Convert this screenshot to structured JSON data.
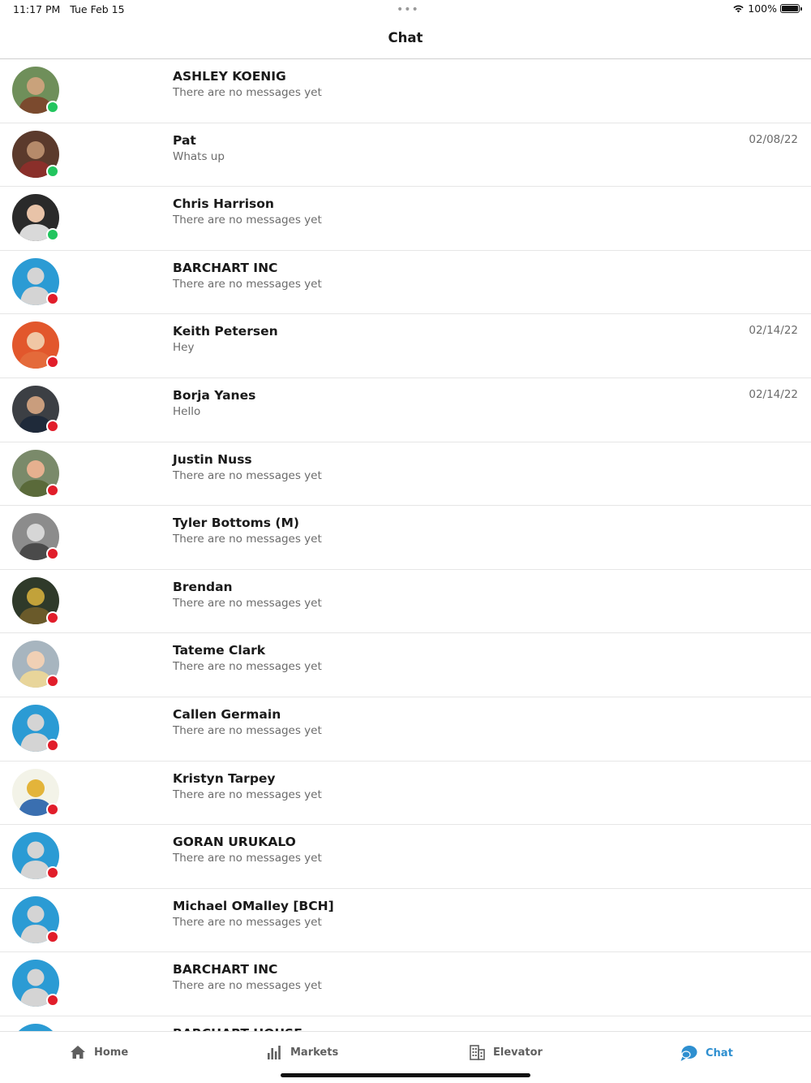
{
  "status_bar": {
    "time": "11:17 PM",
    "date": "Tue Feb 15",
    "battery": "100%",
    "dots": "•••"
  },
  "header": {
    "title": "Chat"
  },
  "colors": {
    "online": "#22c55e",
    "offline": "#e11d2a",
    "accent": "#2e8fd0",
    "placeholder_avatar": "#2b9bd4"
  },
  "chats": [
    {
      "name": "ASHLEY KOENIG",
      "preview": "There are no messages yet",
      "date": "",
      "status": "online",
      "avatar": "photo"
    },
    {
      "name": "Pat",
      "preview": "Whats up",
      "date": "02/08/22",
      "status": "online",
      "avatar": "photo"
    },
    {
      "name": "Chris Harrison",
      "preview": "There are no messages yet",
      "date": "",
      "status": "online",
      "avatar": "photo"
    },
    {
      "name": "BARCHART INC",
      "preview": "There are no messages yet",
      "date": "",
      "status": "offline",
      "avatar": "placeholder"
    },
    {
      "name": "Keith Petersen",
      "preview": "Hey",
      "date": "02/14/22",
      "status": "offline",
      "avatar": "photo"
    },
    {
      "name": "Borja Yanes",
      "preview": "Hello",
      "date": "02/14/22",
      "status": "offline",
      "avatar": "photo"
    },
    {
      "name": "Justin Nuss",
      "preview": "There are no messages yet",
      "date": "",
      "status": "offline",
      "avatar": "photo"
    },
    {
      "name": "Tyler Bottoms (M)",
      "preview": "There are no messages yet",
      "date": "",
      "status": "offline",
      "avatar": "photo"
    },
    {
      "name": "Brendan",
      "preview": "There are no messages yet",
      "date": "",
      "status": "offline",
      "avatar": "photo"
    },
    {
      "name": "Tateme Clark",
      "preview": "There are no messages yet",
      "date": "",
      "status": "offline",
      "avatar": "photo"
    },
    {
      "name": "Callen Germain",
      "preview": "There are no messages yet",
      "date": "",
      "status": "offline",
      "avatar": "placeholder"
    },
    {
      "name": "Kristyn Tarpey",
      "preview": "There are no messages yet",
      "date": "",
      "status": "offline",
      "avatar": "photo"
    },
    {
      "name": "GORAN URUKALO",
      "preview": "There are no messages yet",
      "date": "",
      "status": "offline",
      "avatar": "placeholder"
    },
    {
      "name": "Michael OMalley [BCH]",
      "preview": "There are no messages yet",
      "date": "",
      "status": "offline",
      "avatar": "placeholder"
    },
    {
      "name": "BARCHART INC",
      "preview": "There are no messages yet",
      "date": "",
      "status": "offline",
      "avatar": "placeholder"
    },
    {
      "name": "BARCHART HOUSE",
      "preview": "",
      "date": "",
      "status": "offline",
      "avatar": "placeholder"
    }
  ],
  "tabs": [
    {
      "label": "Home",
      "icon": "home-icon",
      "active": false
    },
    {
      "label": "Markets",
      "icon": "bar-chart-icon",
      "active": false
    },
    {
      "label": "Elevator",
      "icon": "building-icon",
      "active": false
    },
    {
      "label": "Chat",
      "icon": "chat-bubble-icon",
      "active": true
    }
  ]
}
